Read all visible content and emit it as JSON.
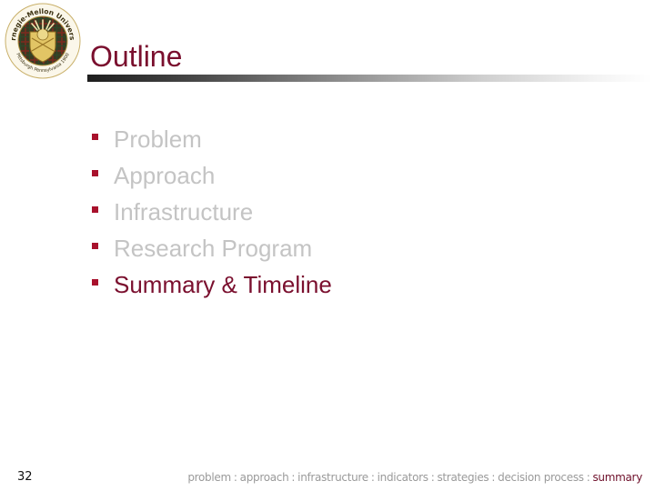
{
  "logo": {
    "top_text": "Carnegie-Mellon University",
    "bottom_text": "Pittsburgh Pennsylvania 1900"
  },
  "slide": {
    "title": "Outline",
    "bullets": [
      {
        "label": "Problem",
        "active": false
      },
      {
        "label": "Approach",
        "active": false
      },
      {
        "label": "Infrastructure",
        "active": false
      },
      {
        "label": "Research Program",
        "active": false
      },
      {
        "label": "Summary & Timeline",
        "active": true
      }
    ],
    "page_number": "32"
  },
  "footer_nav": {
    "separator": ":",
    "items": [
      {
        "label": "problem",
        "active": false
      },
      {
        "label": "approach",
        "active": false
      },
      {
        "label": "infrastructure",
        "active": false
      },
      {
        "label": "indicators",
        "active": false
      },
      {
        "label": "strategies",
        "active": false
      },
      {
        "label": "decision process",
        "active": false
      },
      {
        "label": "summary",
        "active": true
      }
    ]
  },
  "colors": {
    "accent": "#7a0f2e",
    "bullet": "#a8112c",
    "inactive_text": "#c4c4c4",
    "footer_text": "#9a9a9a"
  }
}
